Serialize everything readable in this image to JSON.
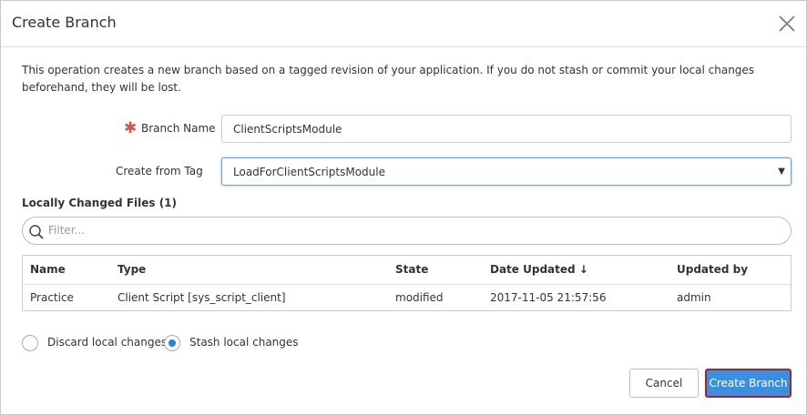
{
  "dialog": {
    "title": "Create Branch",
    "description": "This operation creates a new branch based on a tagged revision of your application. If you do not stash or commit your local changes beforehand, they will be lost."
  },
  "form": {
    "branch_name_label": "Branch Name",
    "branch_name_value": "ClientScriptsModule",
    "required_marker": "✱",
    "create_from_tag_label": "Create from Tag",
    "create_from_tag_value": "LoadForClientScriptsModule"
  },
  "changed_files": {
    "title": "Locally Changed Files (1)",
    "filter_placeholder": "Filter...",
    "columns": [
      "Name",
      "Type",
      "State",
      "Date Updated ↓",
      "Updated by"
    ],
    "rows": [
      {
        "name": "Practice",
        "type": "Client Script [sys_script_client]",
        "state": "modified",
        "date_updated": "2017-11-05 21:57:56",
        "updated_by": "admin"
      }
    ]
  },
  "options": {
    "discard_label": "Discard local changes",
    "stash_label": "Stash local changes",
    "selected": "stash"
  },
  "buttons": {
    "cancel": "Cancel",
    "create": "Create Branch"
  },
  "colors": {
    "primary": "#3b8ee0",
    "required": "#d9534f",
    "focus_outline": "#9b2a2a"
  }
}
